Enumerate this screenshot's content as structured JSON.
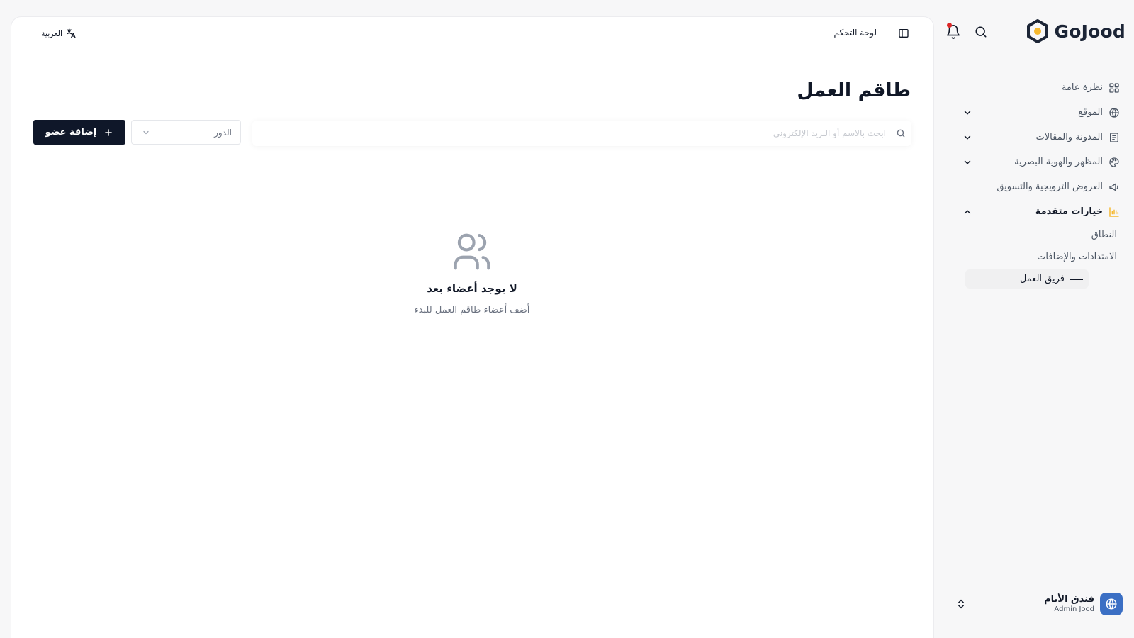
{
  "brand": {
    "name": "GoJood"
  },
  "sidebar": {
    "items": [
      {
        "label": "نظرة عامة"
      },
      {
        "label": "الموقع"
      },
      {
        "label": "المدونة والمقالات"
      },
      {
        "label": "المظهر والهوية البصرية"
      },
      {
        "label": "العروض الترويجية والتسويق"
      },
      {
        "label": "خيارات متقدمة"
      }
    ],
    "sub_items": [
      {
        "label": "النطاق"
      },
      {
        "label": "الامتدادات والإضافات"
      },
      {
        "label": "فريق العمل"
      }
    ],
    "account": {
      "name": "فندق الأيام",
      "role": "Admin Jood"
    }
  },
  "topbar": {
    "dashboard_label": "لوحة التحكم",
    "language_label": "العربية"
  },
  "page": {
    "title": "طاقم العمل"
  },
  "toolbar": {
    "search_placeholder": "ابحث بالاسم أو البريد الإلكتروني",
    "role_placeholder": "الدور",
    "add_button_label": "إضافة عضو"
  },
  "empty_state": {
    "title": "لا يوجد أعضاء بعد",
    "subtitle": "أضف أعضاء طاقم العمل للبدء"
  },
  "colors": {
    "accent": "#f5b82e",
    "primary_button": "#0f1729",
    "notification_dot": "#dc2626"
  },
  "icons": [
    "logo-icon",
    "search-icon",
    "bell-icon",
    "grid-icon",
    "globe-icon",
    "newspaper-icon",
    "palette-icon",
    "megaphone-icon",
    "bar-chart-icon",
    "chevron-down-icon",
    "chevron-up-icon",
    "sidebar-toggle-icon",
    "translate-icon",
    "plus-icon",
    "users-icon",
    "chevrons-up-down-icon"
  ]
}
